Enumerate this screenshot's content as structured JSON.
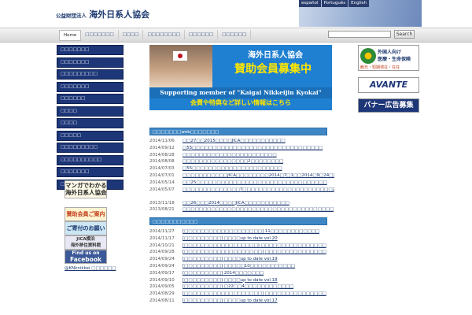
{
  "header": {
    "org_prefix": "公益財団法人",
    "org_name": "海外日系人協会",
    "languages": [
      "español",
      "Português",
      "English"
    ]
  },
  "nav": {
    "items": [
      {
        "label": "Home",
        "active": true
      },
      {
        "label": "□□□□□□□",
        "active": false
      },
      {
        "label": "□□□□",
        "active": false
      },
      {
        "label": "□□□□□□□□",
        "active": false
      },
      {
        "label": "□□□□□□",
        "active": false
      },
      {
        "label": "□□□□□□",
        "active": false
      }
    ],
    "search_placeholder": "",
    "search_button": "Search"
  },
  "sidebar": {
    "items": [
      "□□□□□□□",
      "□□□□□□□",
      "□□□□□□□□□",
      "□□□□□□□",
      "□□□□□□",
      "□□□□",
      "□□□□",
      "□□□□□",
      "□□□□□□□□□",
      "□□□□□□□□□□",
      "□□□□□□□",
      "□□□□□□□"
    ]
  },
  "promos": {
    "manga_line1": "マンガでわかる",
    "manga_line2": "海外日系人協会",
    "support": "賛助会員ご案内",
    "donate": "ご寄付のお願い",
    "jica_line1": "JICA横浜",
    "jica_line2": "海外移住資料館",
    "fb_line1": "Find us on",
    "fb_line2": "Facebook",
    "twitter": "@KNknikkei □□□□□□"
  },
  "hero": {
    "title1": "海外日系人協会",
    "title2": "賛助会員募集中",
    "english": "Supporting member of \"Kaigai Nikkeijin Kyokai\"",
    "sub": "会費や特典など詳しい情報はこちら"
  },
  "ads": {
    "viva_line1": "外国人向け",
    "viva_line2": "医療・生命保険",
    "viva_line3": "観光・短期滞在・在住",
    "avante": "AVANTE",
    "banner": "バナー広告募集"
  },
  "news1": {
    "header": "□□□□□□□web□□□□□□□",
    "rows": [
      {
        "date": "2014/11/06",
        "title": "□□27□□2015□□□□JICA□□□□□□□□□□□",
        "multi": false
      },
      {
        "date": "2014/09/12",
        "title": "□55□□□□□□□□□□□□□□□□□□□□□□□□□□□□□□□□",
        "multi": false
      },
      {
        "date": "2014/08/28",
        "title": "□□□□□□□□□□□□□□□□□□□□□□□",
        "multi": false
      },
      {
        "date": "2014/08/08",
        "title": "□□□□□□□□□□□□□□□□2□□□□□□□□",
        "multi": false
      },
      {
        "date": "2014/07/03",
        "title": "□55□□□□□□□□□□□□□□□□□□□□□□",
        "multi": false
      },
      {
        "date": "2014/07/01",
        "title": "□□□□□□□□□□□JICA□□□□□□□□2014□7□1□□2014□9□24□□",
        "multi": false
      },
      {
        "date": "2014/05/14",
        "title": "□□25□□□□□□□□□□□□□□□□□□□□□□□□□□□□□□□□",
        "multi": false
      },
      {
        "date": "2014/05/07",
        "title": "□□□□□□□□□□□□□□7□□□□□□□□□□□□□□□□□□□□□□2014□6□7□□21□□",
        "multi": true
      },
      {
        "date": "2013/11/18",
        "title": "□□26□□□2014□□□□JICA□□□□□□□□□□□",
        "multi": false
      },
      {
        "date": "2013/08/21",
        "title": "□□□□□□□□□□□□□□□□□□□□□□□□□□□□□□□□□□□□□",
        "multi": false
      }
    ]
  },
  "news2": {
    "header": "□□□□□□□□□□□",
    "rows": [
      {
        "date": "2014/11/27",
        "title": "[□□□□□□□□□□□□□□□□□□□] 11□□□□□□□□□□□□",
        "multi": false
      },
      {
        "date": "2014/11/17",
        "title": "[□□□□□□□□□] □□□□up to date vol.20",
        "multi": false
      },
      {
        "date": "2014/10/21",
        "title": "[□□□□□□□□□□□□□□□□□□] □□□□□□□□□□□□□□□□",
        "multi": false
      },
      {
        "date": "2014/09/28",
        "title": "[□□□□□□□□□□□□□□□□□□□] □□□□□□□□□□□□□□□",
        "multi": false
      },
      {
        "date": "2014/09/24",
        "title": "[□□□□□□□□□] □□□□up to date vol.19",
        "multi": false
      },
      {
        "date": "2014/09/24",
        "title": "[□□□□□□□□□] □□□□□10□□□□□□□□□□□",
        "multi": false
      },
      {
        "date": "2014/09/17",
        "title": "[□□□□□□□□□] 2014□□□□□□□",
        "multi": false
      },
      {
        "date": "2014/09/10",
        "title": "[□□□□□□□□□] □□□□up to date vol.18",
        "multi": false
      },
      {
        "date": "2014/09/05",
        "title": "[□□□□□□□□□] □22□□4□□□□□□□□□□□□",
        "multi": false
      },
      {
        "date": "2014/08/29",
        "title": "[□□□□□□□□□□□□□□□□□□□] □□□□□□□□□□□□□□□",
        "multi": false
      },
      {
        "date": "2014/08/11",
        "title": "[□□□□□□□□□] □□□□up to date vol.17",
        "multi": false
      }
    ]
  }
}
